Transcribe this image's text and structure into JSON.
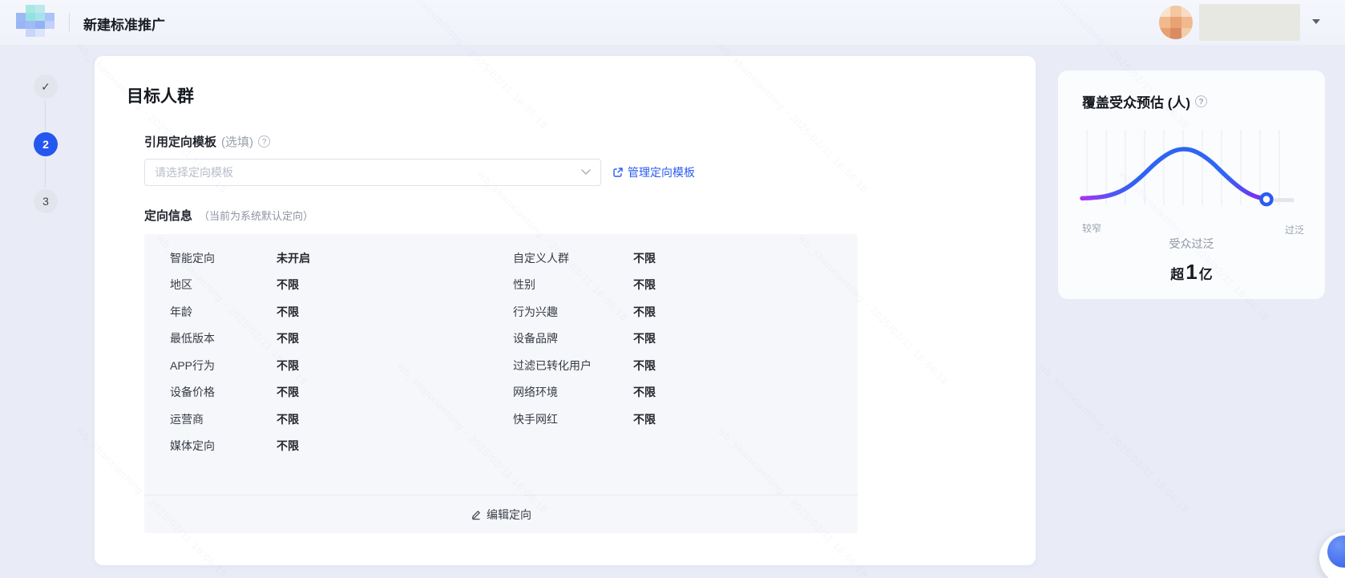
{
  "watermark_text": "wb_shanxiaotong - 2025/02/11 16:06:18",
  "header": {
    "title": "新建标准推广"
  },
  "steps": [
    {
      "glyph": "✓",
      "state": "done"
    },
    {
      "glyph": "2",
      "state": "active"
    },
    {
      "glyph": "3",
      "state": "pending"
    }
  ],
  "audience": {
    "section_title": "目标人群",
    "template_label": "引用定向模板",
    "template_label_note": "(选填)",
    "template_placeholder": "请选择定向模板",
    "manage_template_link": "管理定向模板",
    "targeting_title": "定向信息",
    "targeting_note": "（当前为系统默认定向）",
    "rows_left": [
      {
        "label": "智能定向",
        "value": "未开启"
      },
      {
        "label": "地区",
        "value": "不限"
      },
      {
        "label": "年龄",
        "value": "不限"
      },
      {
        "label": "最低版本",
        "value": "不限"
      },
      {
        "label": "APP行为",
        "value": "不限"
      },
      {
        "label": "设备价格",
        "value": "不限"
      },
      {
        "label": "运营商",
        "value": "不限"
      },
      {
        "label": "媒体定向",
        "value": "不限"
      }
    ],
    "rows_right": [
      {
        "label": "自定义人群",
        "value": "不限"
      },
      {
        "label": "性别",
        "value": "不限"
      },
      {
        "label": "行为兴趣",
        "value": "不限"
      },
      {
        "label": "设备品牌",
        "value": "不限"
      },
      {
        "label": "过滤已转化用户",
        "value": "不限"
      },
      {
        "label": "网络环境",
        "value": "不限"
      },
      {
        "label": "快手网红",
        "value": "不限"
      }
    ],
    "edit_action": "编辑定向"
  },
  "estimate": {
    "title": "覆盖受众预估 (人)",
    "scale_left": "较窄",
    "scale_right": "过泛",
    "status": "受众过泛",
    "value": {
      "prefix": "超",
      "number": "1",
      "unit": "亿"
    },
    "chart_data": {
      "type": "line",
      "description": "audience reach bell curve, indicator dot at far right end (audience too broad)",
      "x_range_labels": [
        "较窄",
        "过泛"
      ],
      "points_normalized": [
        [
          0,
          0.04
        ],
        [
          0.08,
          0.05
        ],
        [
          0.16,
          0.1
        ],
        [
          0.24,
          0.22
        ],
        [
          0.32,
          0.44
        ],
        [
          0.4,
          0.72
        ],
        [
          0.48,
          0.92
        ],
        [
          0.55,
          0.985
        ],
        [
          0.62,
          0.93
        ],
        [
          0.7,
          0.74
        ],
        [
          0.78,
          0.46
        ],
        [
          0.86,
          0.22
        ],
        [
          0.93,
          0.08
        ],
        [
          1,
          0.02
        ]
      ],
      "marker_t": 1.0,
      "tail_t": [
        1.05,
        1.14
      ],
      "gridline_count": 11,
      "line_gradient": [
        "#a733f2",
        "#2e63f4",
        "#8c2cf2"
      ],
      "marker_color": "#2b5cf0",
      "grid_on": true
    }
  },
  "icons": {
    "help_glyph": "?"
  },
  "colors": {
    "accent_blue": "#2b5cf0",
    "page_bg": "#e9ecf6",
    "table_bg": "#f6f7fa",
    "active_step": "#2456f0"
  }
}
